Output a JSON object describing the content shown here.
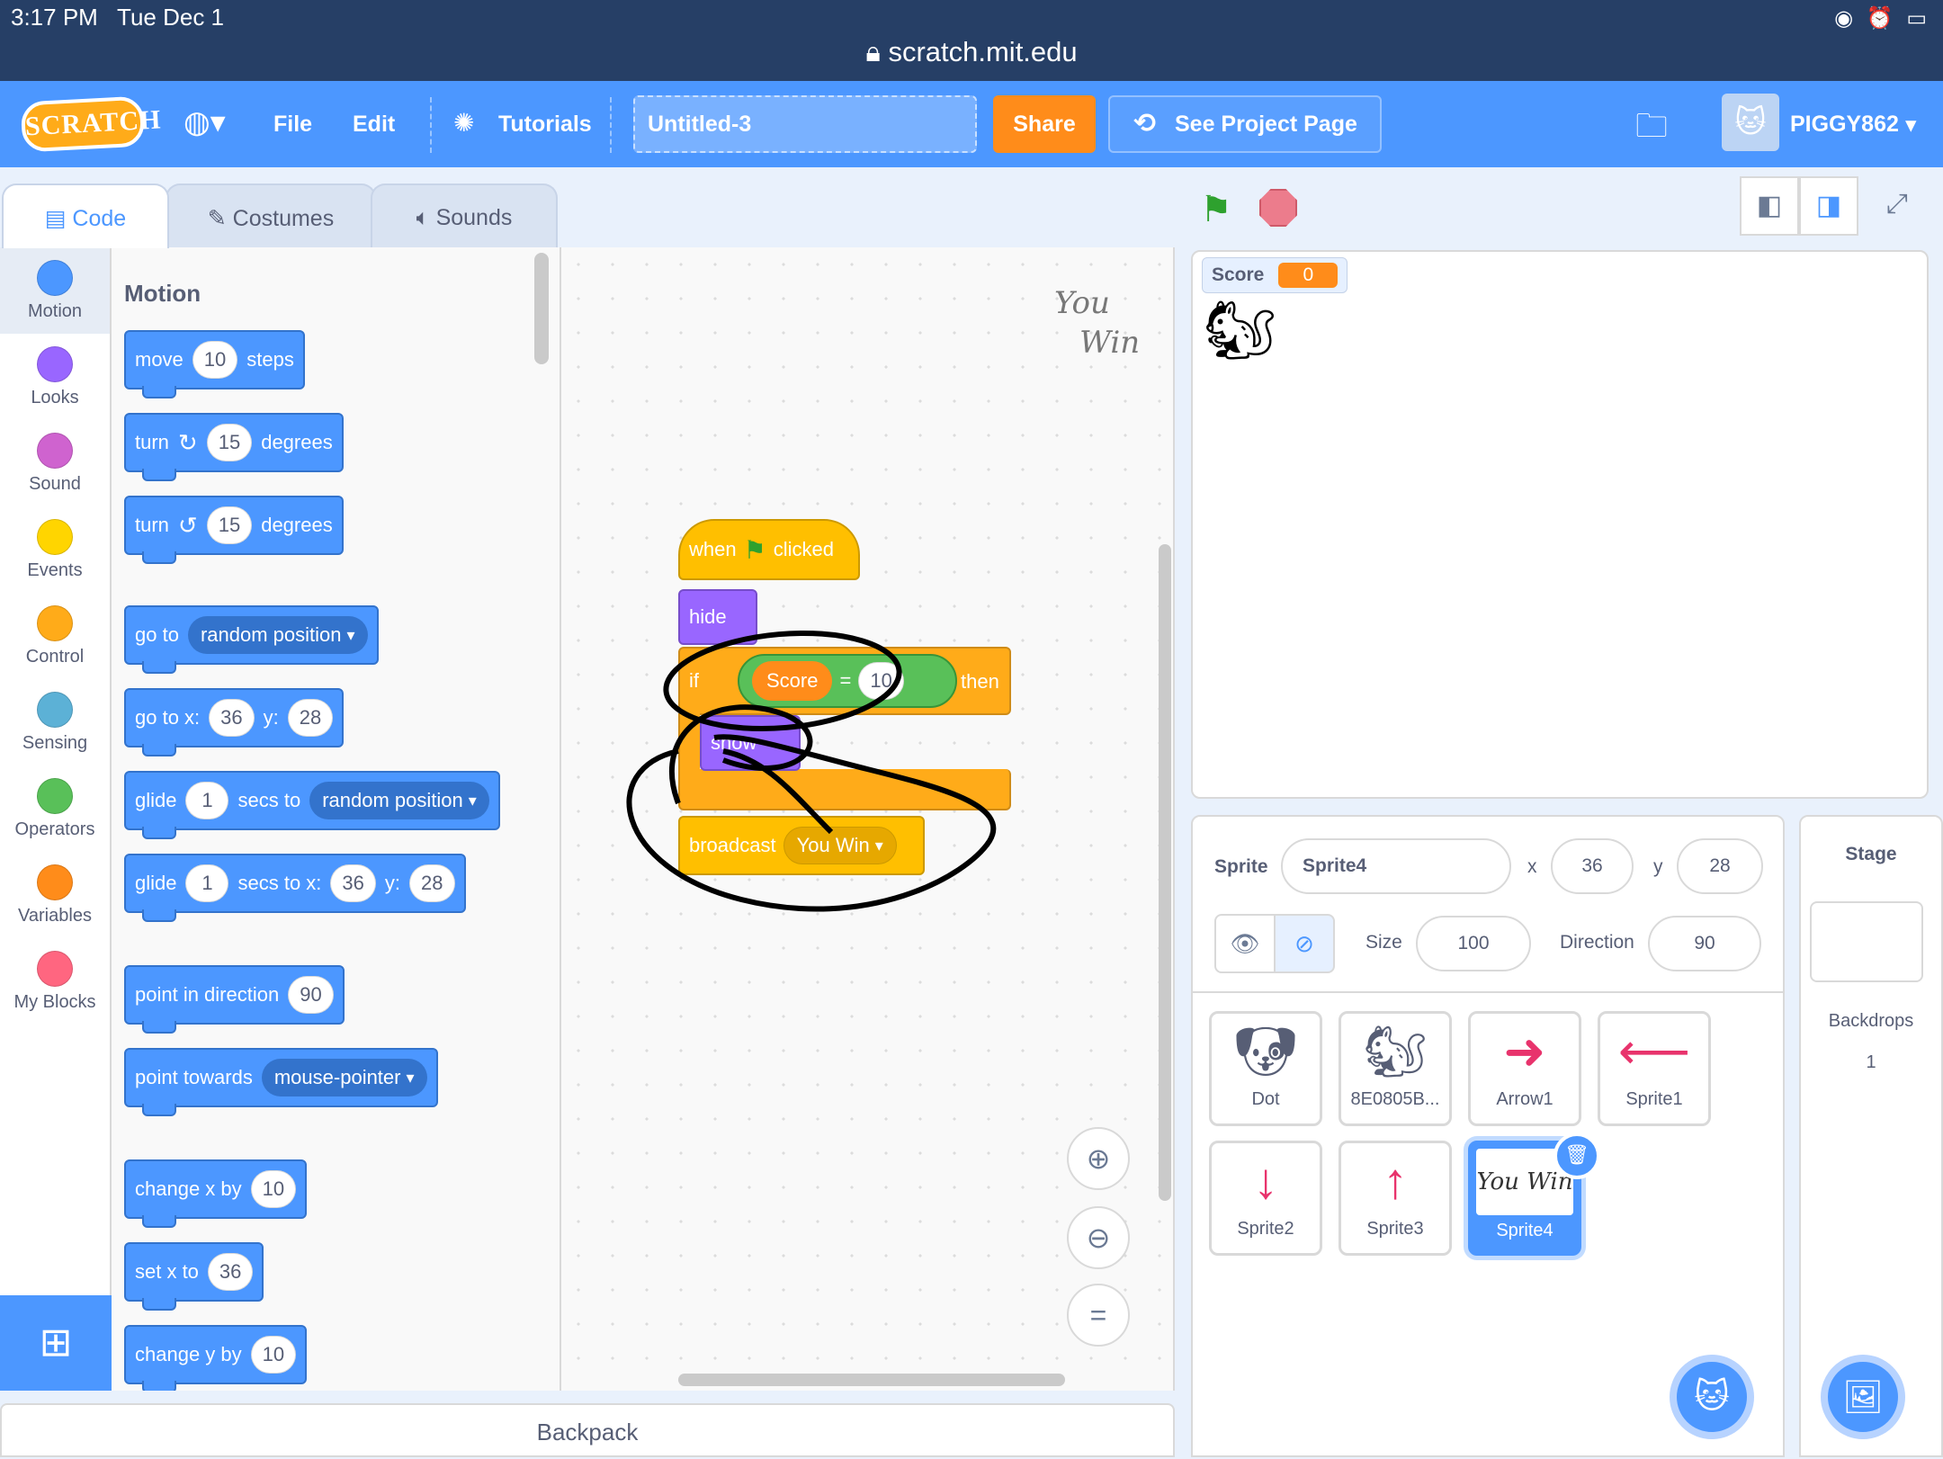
{
  "status": {
    "time": "3:17 PM   Tue Dec 1",
    "url": "scratch.mit.edu"
  },
  "menu": {
    "logo": "SCRATCH",
    "file": "File",
    "edit": "Edit",
    "tutorials": "Tutorials",
    "project_title": "Untitled-3",
    "share": "Share",
    "see_project_page": "See Project Page",
    "username": "PIGGY862"
  },
  "tabs": {
    "code": "Code",
    "costumes": "Costumes",
    "sounds": "Sounds"
  },
  "categories": [
    {
      "label": "Motion",
      "color": "#4c97ff"
    },
    {
      "label": "Looks",
      "color": "#9966ff"
    },
    {
      "label": "Sound",
      "color": "#cf63cf"
    },
    {
      "label": "Events",
      "color": "#ffd500"
    },
    {
      "label": "Control",
      "color": "#ffab19"
    },
    {
      "label": "Sensing",
      "color": "#5cb1d6"
    },
    {
      "label": "Operators",
      "color": "#59c059"
    },
    {
      "label": "Variables",
      "color": "#ff8c1a"
    },
    {
      "label": "My Blocks",
      "color": "#ff6680"
    }
  ],
  "palette": {
    "heading": "Motion",
    "move": {
      "a": "move",
      "v": "10",
      "b": "steps"
    },
    "turn_cw": {
      "a": "turn",
      "v": "15",
      "b": "degrees"
    },
    "turn_ccw": {
      "a": "turn",
      "v": "15",
      "b": "degrees"
    },
    "goto": {
      "a": "go to",
      "dd": "random position"
    },
    "goto_xy": {
      "a": "go to x:",
      "x": "36",
      "b": "y:",
      "y": "28"
    },
    "glide": {
      "a": "glide",
      "v": "1",
      "b": "secs to",
      "dd": "random position"
    },
    "glide_xy": {
      "a": "glide",
      "v": "1",
      "b": "secs to x:",
      "x": "36",
      "c": "y:",
      "y": "28"
    },
    "point_dir": {
      "a": "point in direction",
      "v": "90"
    },
    "point_towards": {
      "a": "point towards",
      "dd": "mouse-pointer"
    },
    "change_x": {
      "a": "change x by",
      "v": "10"
    },
    "set_x": {
      "a": "set x to",
      "v": "36"
    },
    "change_y": {
      "a": "change y by",
      "v": "10"
    }
  },
  "script": {
    "when": "when",
    "clicked": "clicked",
    "hide": "hide",
    "if": "if",
    "cond_var": "Score",
    "cond_op": "=",
    "cond_val": "10",
    "then": "then",
    "show": "show",
    "broadcast": "broadcast",
    "broadcast_msg": "You Win",
    "note_line1": "You",
    "note_line2": "Win"
  },
  "stage": {
    "monitor_label": "Score",
    "monitor_value": "0"
  },
  "sprite_info": {
    "sprite_label": "Sprite",
    "sprite_name": "Sprite4",
    "x_label": "x",
    "x": "36",
    "y_label": "y",
    "y": "28",
    "size_label": "Size",
    "size": "100",
    "direction_label": "Direction",
    "direction": "90"
  },
  "sprites": [
    "Dot",
    "8E0805B...",
    "Arrow1",
    "Sprite1",
    "Sprite2",
    "Sprite3",
    "Sprite4"
  ],
  "stage_panel": {
    "title": "Stage",
    "backdrops_label": "Backdrops",
    "backdrops_count": "1"
  },
  "backpack": "Backpack"
}
